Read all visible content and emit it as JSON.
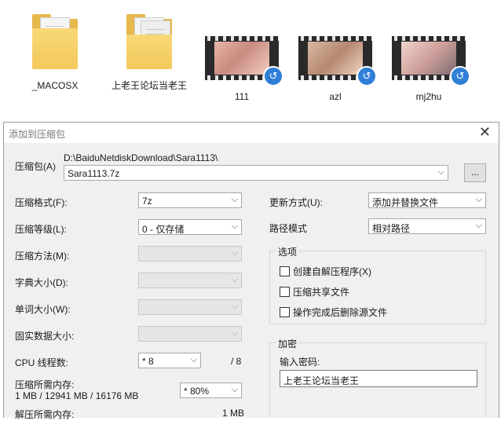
{
  "files": [
    {
      "name": "_MACOSX",
      "kind": "folder"
    },
    {
      "name": "上老王论坛当老王",
      "kind": "folder"
    },
    {
      "name": "111",
      "kind": "video"
    },
    {
      "name": "azl",
      "kind": "video"
    },
    {
      "name": "mj2hu",
      "kind": "video"
    }
  ],
  "dialog": {
    "title": "添加到压缩包",
    "archive": {
      "label": "压缩包(A)",
      "path": "D:\\BaiduNetdiskDownload\\Sara1113\\",
      "name": "Sara1113.7z",
      "browse_label": "..."
    },
    "left": {
      "format": {
        "label": "压缩格式(F):",
        "value": "7z"
      },
      "level": {
        "label": "压缩等级(L):",
        "value": "0 - 仅存储"
      },
      "method": {
        "label": "压缩方法(M):",
        "value": ""
      },
      "dict_size": {
        "label": "字典大小(D):",
        "value": ""
      },
      "word_size": {
        "label": "单词大小(W):",
        "value": ""
      },
      "solid_size": {
        "label": "固实数据大小:",
        "value": ""
      },
      "cpu_threads": {
        "label": "CPU 线程数:",
        "value": "* 8",
        "max": "/ 8"
      },
      "mem_compress": {
        "label": "压缩所需内存:",
        "detail": "1 MB / 12941 MB / 16176 MB",
        "value": "* 80%"
      },
      "mem_decompress": {
        "label": "解压所需内存:",
        "value": "1 MB"
      }
    },
    "right": {
      "update_mode": {
        "label": "更新方式(U):",
        "value": "添加并替换文件"
      },
      "path_mode": {
        "label": "路径模式",
        "value": "相对路径"
      },
      "options": {
        "legend": "选项",
        "items": [
          {
            "label": "创建自解压程序(X)",
            "checked": false
          },
          {
            "label": "压缩共享文件",
            "checked": false
          },
          {
            "label": "操作完成后删除源文件",
            "checked": false
          }
        ]
      },
      "encryption": {
        "legend": "加密",
        "password_label": "输入密码:",
        "password_value": "上老王论坛当老王"
      }
    }
  }
}
